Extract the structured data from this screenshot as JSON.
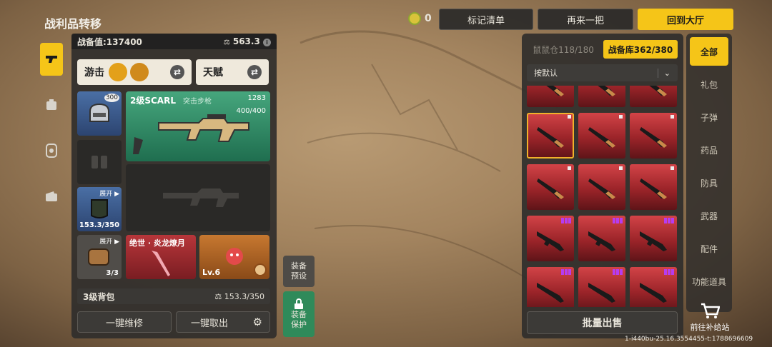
{
  "header": {
    "title": "战利品转移",
    "coin_count": "0",
    "mark_list": "标记清单",
    "again": "再来一把",
    "back_lobby": "回到大厅"
  },
  "loadout": {
    "equip_value_label": "战备值:137400",
    "weight": "563.3",
    "mode_label": "游击",
    "talent_label": "天赋",
    "helmet_level": "300",
    "primary": {
      "name": "2级SCARL",
      "type": "突击步枪",
      "value": "1283",
      "ammo": "400/400"
    },
    "armor_expand": "展开",
    "armor_durability": "153.3/350",
    "bag_expand": "展开",
    "bag_count": "3/3",
    "melee_name": "绝世 · 炎龙燎月",
    "pet_level": "Lv.6",
    "backpack_name": "3级背包",
    "backpack_capacity": "153.3/350",
    "repair_all": "一键维修",
    "take_all": "一键取出",
    "preset_label": "装备预设",
    "protect_label": "装备保护"
  },
  "storage": {
    "tab_mouse": "鼠鼠仓118/180",
    "tab_armory": "战备库362/380",
    "sort_label": "按默认",
    "bulk_sell": "批量出售",
    "categories": [
      "全部",
      "礼包",
      "子弹",
      "药品",
      "防具",
      "武器",
      "配件",
      "功能道具"
    ],
    "go_supply": "前往补给站"
  },
  "footer": {
    "build_id": "1-i440bu-25.16.3554455-t:1788696609"
  }
}
